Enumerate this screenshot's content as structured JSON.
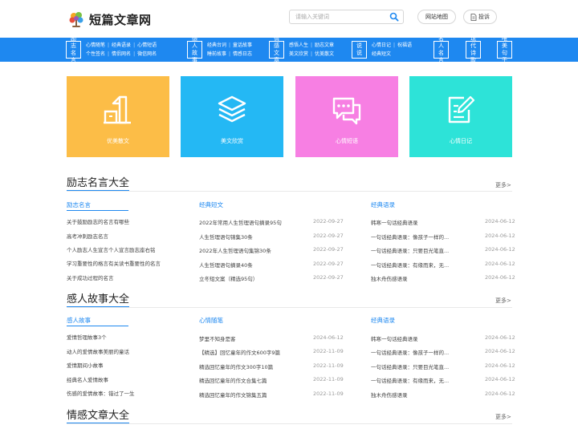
{
  "header": {
    "logo_text": "短篇文章网",
    "search_placeholder": "请输入关键词",
    "map_label": "网站地图",
    "tougao_label": "投诉"
  },
  "nav": [
    {
      "label": "励志名言",
      "rows": [
        [
          "心情随笔",
          "经典语录",
          "心情短语"
        ],
        [
          "个性签名",
          "情侣网名",
          "微信网名"
        ]
      ]
    },
    {
      "label": "感人故事",
      "rows": [
        [
          "经典台词",
          "童话故事"
        ],
        [
          "睡前故事",
          "情感日志"
        ]
      ]
    },
    {
      "label": "情感文章",
      "rows": [
        [
          "感悟人生",
          "励志文章"
        ],
        [
          "美文欣赏",
          "优美散文"
        ]
      ]
    },
    {
      "label": "说说",
      "rows": [
        [
          "心情日记",
          "祝福语"
        ],
        [
          "经典短文"
        ]
      ]
    },
    {
      "label": "名人名言",
      "rows": []
    },
    {
      "label": "现代诗歌",
      "rows": []
    },
    {
      "label": "唯美句子",
      "rows": []
    }
  ],
  "tiles": [
    {
      "label": "优美散文",
      "color": "#fcbd47",
      "icon": "podium-icon"
    },
    {
      "label": "美文欣赏",
      "color": "#24b8f4",
      "icon": "layers-icon"
    },
    {
      "label": "心情短语",
      "color": "#f77fe3",
      "icon": "chat-icon"
    },
    {
      "label": "心情日记",
      "color": "#2de3d8",
      "icon": "note-edit-icon"
    }
  ],
  "sections": [
    {
      "title": "励志名言大全",
      "more": "更多>",
      "columns": [
        {
          "title": "励志名言",
          "items": [
            {
              "text": "关于鼓励励志的名言有哪些",
              "date": ""
            },
            {
              "text": "高考冲刺励志名言",
              "date": ""
            },
            {
              "text": "个人励志人生宣言个人宣言励志座右铭",
              "date": ""
            },
            {
              "text": "学习重要性的格言有关读书重要性的名言",
              "date": ""
            },
            {
              "text": "关于成功过程的名言",
              "date": ""
            }
          ]
        },
        {
          "title": "经典短文",
          "items": [
            {
              "text": "2022年常用人生哲理语句摘录95句",
              "date": "2022-09-27"
            },
            {
              "text": "人生哲理语句锦集30条",
              "date": "2022-09-27"
            },
            {
              "text": "2022年人生哲理语句集锦30条",
              "date": "2022-09-27"
            },
            {
              "text": "人生哲理语句摘录40条",
              "date": "2022-09-27"
            },
            {
              "text": "立冬短文案（精选95句）",
              "date": "2022-09-27"
            }
          ]
        },
        {
          "title": "经典语录",
          "items": [
            {
              "text": "韩寒一句话经典语录",
              "date": "2024-06-12"
            },
            {
              "text": "一句话经典语录：像孩子一样的...",
              "date": "2024-06-12"
            },
            {
              "text": "一句话经典语录：只要目光笔直...",
              "date": "2024-06-12"
            },
            {
              "text": "一句话经典语录：有缘而来，无...",
              "date": "2024-06-12"
            },
            {
              "text": "独木舟伤感语录",
              "date": "2024-06-12"
            }
          ]
        }
      ]
    },
    {
      "title": "感人故事大全",
      "more": "更多>",
      "columns": [
        {
          "title": "感人故事",
          "items": [
            {
              "text": "爱情哲理故事3个",
              "date": ""
            },
            {
              "text": "动人的爱情故事美丽的童话",
              "date": ""
            },
            {
              "text": "爱情期间小故事",
              "date": ""
            },
            {
              "text": "经典名人爱情故事",
              "date": ""
            },
            {
              "text": "伤感的爱情故事：错过了一生",
              "date": ""
            }
          ]
        },
        {
          "title": "心情随笔",
          "items": [
            {
              "text": "梦里不知身是客",
              "date": "2024-06-12"
            },
            {
              "text": "【精选】回忆童年的作文600字9篇",
              "date": "2022-11-09"
            },
            {
              "text": "精选回忆童年的作文300字10篇",
              "date": "2022-11-09"
            },
            {
              "text": "精选回忆童年的作文合集七篇",
              "date": "2022-11-09"
            },
            {
              "text": "精选回忆童年的作文锦集五篇",
              "date": "2022-11-09"
            }
          ]
        },
        {
          "title": "经典语录",
          "items": [
            {
              "text": "韩寒一句话经典语录",
              "date": "2024-06-12"
            },
            {
              "text": "一句话经典语录：像孩子一样的...",
              "date": "2024-06-12"
            },
            {
              "text": "一句话经典语录：只要目光笔直...",
              "date": "2024-06-12"
            },
            {
              "text": "一句话经典语录：有缘而来，无...",
              "date": "2024-06-12"
            },
            {
              "text": "独木舟伤感语录",
              "date": "2024-06-12"
            }
          ]
        }
      ]
    },
    {
      "title": "情感文章大全",
      "more": "更多>",
      "columns": []
    }
  ]
}
